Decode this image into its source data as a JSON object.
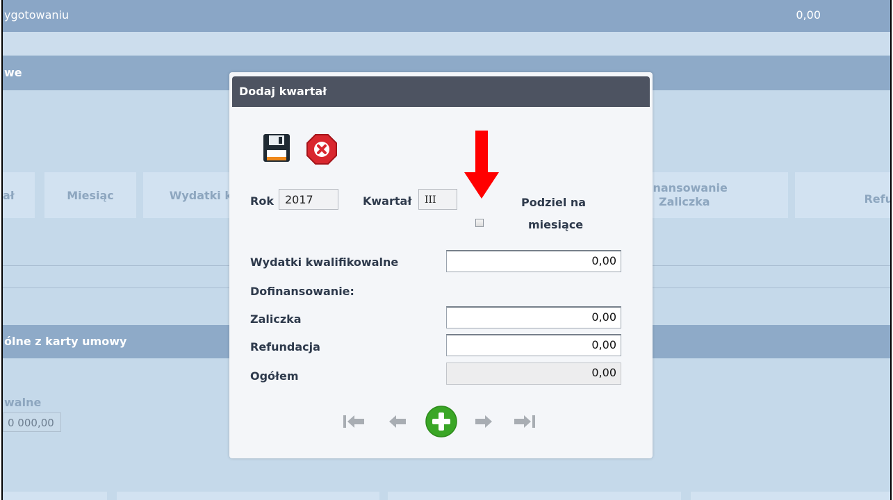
{
  "background": {
    "top_bar_text": "ygotowaniu",
    "top_bar_amount": "0,00",
    "section1_title": "we",
    "table_headers": [
      "ał",
      "Miesiąc",
      "Wydatki k",
      "inansowanie\nZaliczka",
      "Refu"
    ],
    "section2_title": "ólne z karty umowy",
    "field_label": "walne",
    "field_value": "0 000,00"
  },
  "dialog": {
    "title": "Dodaj kwartał",
    "year_label": "Rok",
    "year_value": "2017",
    "quarter_label": "Kwartał",
    "quarter_value": "III",
    "split_label_line1": "Podziel na",
    "split_label_line2": "miesiące",
    "split_checked": false,
    "eligible_label": "Wydatki kwalifikowalne",
    "eligible_value": "0,00",
    "cofinancing_label": "Dofinansowanie:",
    "advance_label": "Zaliczka",
    "advance_value": "0,00",
    "refund_label": "Refundacja",
    "refund_value": "0,00",
    "total_label": "Ogółem",
    "total_value": "0,00"
  },
  "icons": {
    "save": "floppy-disk-icon",
    "cancel": "stop-x-icon",
    "annotation": "red-down-arrow",
    "nav": [
      "first-icon",
      "prev-icon",
      "add-icon",
      "next-icon",
      "last-icon"
    ]
  },
  "colors": {
    "dialog_title_bg": "#4d5361",
    "add_green": "#3aa626",
    "cancel_red": "#d9272e",
    "arrow_red": "#ff0000"
  }
}
